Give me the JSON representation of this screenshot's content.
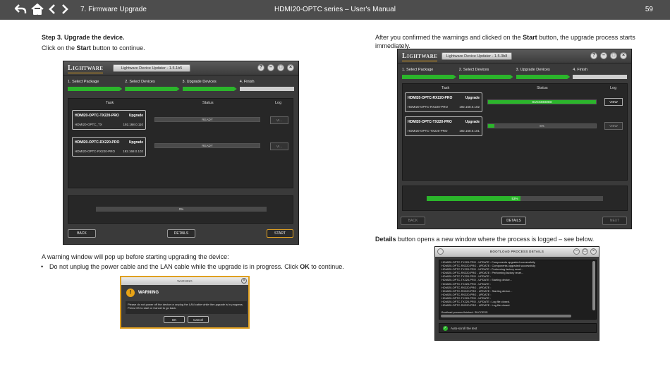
{
  "header": {
    "section": "7. Firmware Upgrade",
    "title": "HDMI20-OPTC series – User's Manual",
    "page": "59"
  },
  "left": {
    "step_heading": "Step 3.  Upgrade the device.",
    "instruction_pre": "Click on the ",
    "instruction_bold": "Start",
    "instruction_post": " button to continue.",
    "warning_intro": "A warning window will pop up before starting upgrading the device:",
    "bullet_pre": "Do not unplug the power cable and the LAN cable while the upgrade is in progress. Click ",
    "bullet_bold": "OK",
    "bullet_post": " to continue."
  },
  "right": {
    "intro_pre": "After you confirmed the warnings and clicked on the ",
    "intro_bold": "Start",
    "intro_post": " button, the upgrade process starts immediately.",
    "details_bold": "Details",
    "details_post": " button opens a new window where the process is logged – see below."
  },
  "app1": {
    "logo": "Lightware",
    "version": "Lightware Device Updater - 1.5.1b5",
    "steps": [
      "1. Select Package",
      "2. Select Devices",
      "3. Upgrade Devices",
      "4. Finish"
    ],
    "col_task": "Task",
    "col_status": "Status",
    "col_log": "Log",
    "devices": [
      {
        "name": "HDMI20-OPTC-TX220-PRO",
        "tag": "Upgrade",
        "label": "HDMI20-OPTC_TX",
        "ip": "192.168.0.110",
        "status": "READY",
        "log": "VI..."
      },
      {
        "name": "HDMI20-OPTC-RX220-PRO",
        "tag": "Upgrade",
        "label": "HDMI20-OPTC-RX220-PRO",
        "ip": "192.168.0.102",
        "status": "READY",
        "log": "VI..."
      }
    ],
    "overall": "0%",
    "back": "BACK",
    "details": "DETAILS",
    "start": "START"
  },
  "app2": {
    "logo": "Lightware",
    "version": "Lightware Device Updater - 1.5.3b8",
    "steps": [
      "1. Select Package",
      "2. Select Devices",
      "3. Upgrade Devices",
      "4. Finish"
    ],
    "col_task": "Task",
    "col_status": "Status",
    "col_log": "Log",
    "devices": [
      {
        "name": "HDMI20-OPTC-RX220-PRO",
        "tag": "Upgrade",
        "label": "HDMI20-OPTC-RX220-PRO",
        "ip": "192.168.0.102",
        "status": "SUCCEEDED",
        "progress": 1.0,
        "log": "VIEW"
      },
      {
        "name": "HDMI20-OPTC-TX220-PRO",
        "tag": "Upgrade",
        "label": "HDMI20-OPTC-TX220-PRO",
        "ip": "192.168.0.101",
        "status": "6%",
        "progress": 0.06,
        "log": "VIEW"
      }
    ],
    "overall": "53%",
    "overall_progress": 0.53,
    "back": "BACK",
    "details": "DETAILS",
    "next": "NEXT"
  },
  "warning": {
    "window_title": "WARNING",
    "title": "WARNING",
    "message": "Please do not power off the device or unplug the LAN cable while the upgrade is in progress. Press OK to start or Cancel to go back.",
    "ok": "OK",
    "cancel": "Cancel"
  },
  "boot": {
    "window_title": "BOOTLOAD PROCESS DETAILS",
    "lines": [
      "HDMI20-OPTC-TX220-PRO - UPDATE : Components upgraded successfully",
      "HDMI20-OPTC-RX220-PRO - UPDATE : Components upgraded successfully",
      "HDMI20-OPTC-TX220-PRO - UPDATE : Performing factory reset...",
      "HDMI20-OPTC-RX220-PRO - UPDATE : Performing factory reset...",
      "HDMI20-OPTC-TX220-PRO - UPDATE :",
      "HDMI20-OPTC-TX220-PRO - UPDATE : Starting device...",
      "HDMI20-OPTC-TX220-PRO - UPDATE :",
      "HDMI20-OPTC-RX220-PRO - UPDATE :",
      "HDMI20-OPTC-RX220-PRO - UPDATE : Starting device...",
      "HDMI20-OPTC-RX220-PRO - UPDATE :",
      "HDMI20-OPTC-TX220-PRO - UPDATE :",
      "HDMI20-OPTC-TX220-PRO - UPDATE : Log file closed.",
      "HDMI20-OPTC-RX220-PRO - UPDATE : Log file closed.",
      "",
      "Bootload process finished: SUCCESS"
    ],
    "autoscroll": "Auto-scroll the text"
  }
}
